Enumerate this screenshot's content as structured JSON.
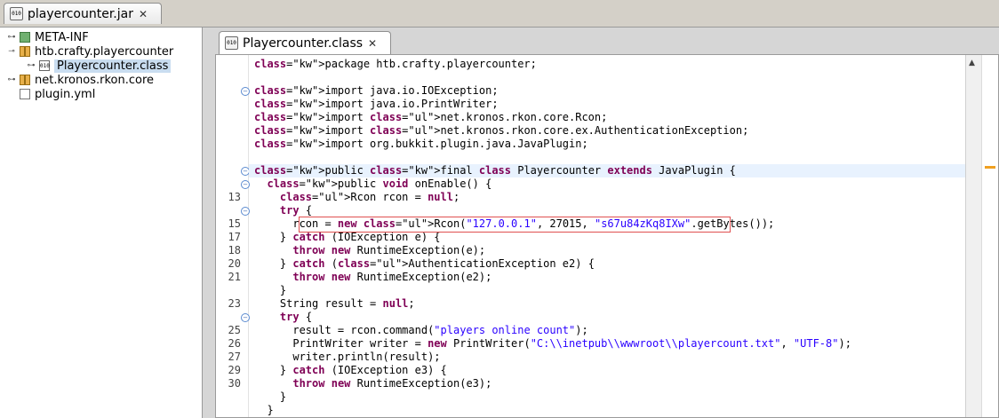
{
  "outer_tab": {
    "label": "playercounter.jar",
    "icon": "jar-icon",
    "close": "✕"
  },
  "tree": {
    "items": [
      {
        "label": "META-INF",
        "icon": "folder-icon",
        "toggle": "⊶"
      },
      {
        "label": "htb.crafty.playercounter",
        "icon": "package-icon",
        "toggle": "⊸"
      },
      {
        "label": "Playercounter.class",
        "icon": "class-icon",
        "toggle": "⊶",
        "selected": true
      },
      {
        "label": "net.kronos.rkon.core",
        "icon": "package-icon",
        "toggle": "⊶"
      },
      {
        "label": "plugin.yml",
        "icon": "file-icon",
        "toggle": ""
      }
    ]
  },
  "editor_tab": {
    "label": "Playercounter.class",
    "icon": "class-icon",
    "close": "✕"
  },
  "code": {
    "line_numbers": [
      "13",
      "15",
      "17",
      "18",
      "20",
      "21",
      "23",
      "25",
      "26",
      "27",
      "29",
      "30"
    ],
    "lines": [
      "package htb.crafty.playercounter;",
      "",
      "import java.io.IOException;",
      "import java.io.PrintWriter;",
      "import net.kronos.rkon.core.Rcon;",
      "import net.kronos.rkon.core.ex.AuthenticationException;",
      "import org.bukkit.plugin.java.JavaPlugin;",
      "",
      "public final class Playercounter extends JavaPlugin {",
      "  public void onEnable() {",
      "    Rcon rcon = null;",
      "    try {",
      "      rcon = new Rcon(\"127.0.0.1\", 27015, \"s67u84zKq8IXw\".getBytes());",
      "    } catch (IOException e) {",
      "      throw new RuntimeException(e);",
      "    } catch (AuthenticationException e2) {",
      "      throw new RuntimeException(e2);",
      "    }",
      "    String result = null;",
      "    try {",
      "      result = rcon.command(\"players online count\");",
      "      PrintWriter writer = new PrintWriter(\"C:\\\\inetpub\\\\wwwroot\\\\playercount.txt\", \"UTF-8\");",
      "      writer.println(result);",
      "    } catch (IOException e3) {",
      "      throw new RuntimeException(e3);",
      "    }",
      "  }"
    ],
    "highlight_color": "#e8f2fe",
    "keyword_color": "#7f0055",
    "string_color": "#2a00ff"
  }
}
